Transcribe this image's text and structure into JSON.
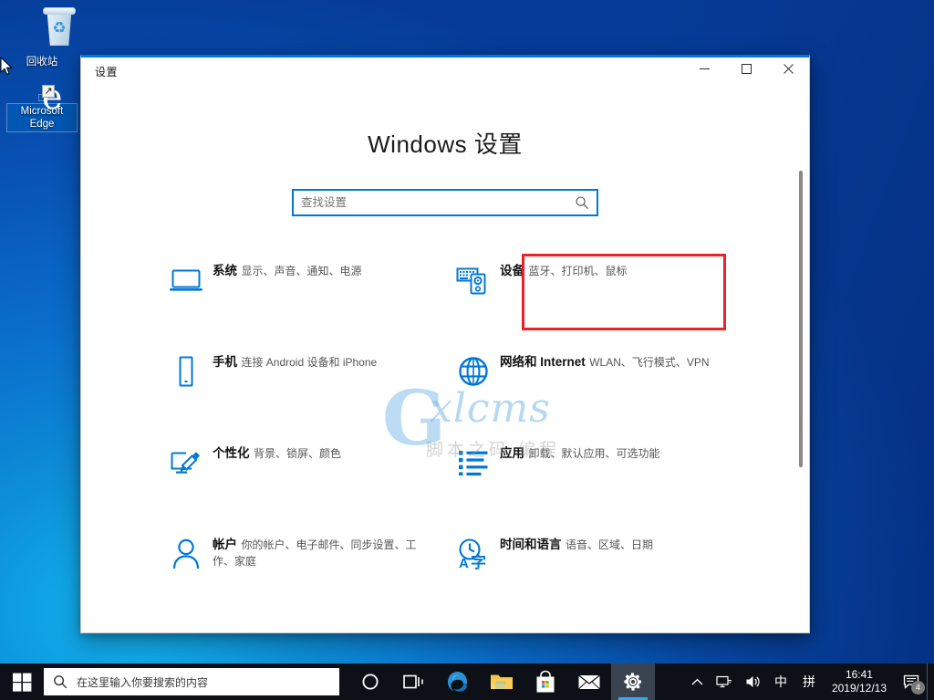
{
  "desktop": {
    "icons": [
      {
        "name": "recycle-bin",
        "label": "回收站",
        "icon": "recycle-bin-icon",
        "selected": false
      },
      {
        "name": "microsoft-edge",
        "label": "Microsoft Edge",
        "icon": "edge-icon",
        "selected": true,
        "shortcut_arrow": "↗"
      }
    ],
    "wallpaper_colors": {
      "primary": "#0d8fd8",
      "secondary": "#053a8f"
    }
  },
  "window": {
    "title": "设置",
    "accent_color": "#0078d7",
    "controls": {
      "minimize": "—",
      "maximize": "▢",
      "close": "✕"
    },
    "page_title": "Windows 设置",
    "search": {
      "placeholder": "查找设置",
      "value": "",
      "icon": "search-icon",
      "focused": true
    },
    "scrollbar": {
      "visible": true,
      "thumb_position_percent": 0
    },
    "tiles": [
      {
        "id": "system",
        "icon": "monitor-icon",
        "name": "系统",
        "desc": "显示、声音、通知、电源",
        "highlighted": false
      },
      {
        "id": "devices",
        "icon": "devices-icon",
        "name": "设备",
        "desc": "蓝牙、打印机、鼠标",
        "highlighted": true
      },
      {
        "id": "phone",
        "icon": "phone-icon",
        "name": "手机",
        "desc": "连接 Android 设备和 iPhone",
        "highlighted": false
      },
      {
        "id": "network",
        "icon": "globe-icon",
        "name": "网络和 Internet",
        "desc": "WLAN、飞行模式、VPN",
        "highlighted": false
      },
      {
        "id": "personalization",
        "icon": "brush-icon",
        "name": "个性化",
        "desc": "背景、锁屏、颜色",
        "highlighted": false
      },
      {
        "id": "apps",
        "icon": "list-icon",
        "name": "应用",
        "desc": "卸载、默认应用、可选功能",
        "highlighted": false
      },
      {
        "id": "accounts",
        "icon": "person-icon",
        "name": "帐户",
        "desc": "你的帐户、电子邮件、同步设置、工作、家庭",
        "highlighted": false
      },
      {
        "id": "time-language",
        "icon": "clock-language-icon",
        "name": "时间和语言",
        "desc": "语音、区域、日期",
        "highlighted": false
      }
    ],
    "annotation": {
      "color": "#ec2227",
      "target_tile": "devices"
    }
  },
  "watermark": {
    "letter": "G",
    "name": "xlcms",
    "subtitle": "脚本之码 编程"
  },
  "taskbar": {
    "start": {
      "icon": "windows-logo-icon",
      "label": "开始"
    },
    "search": {
      "icon": "search-icon",
      "placeholder": "在这里输入你要搜索的内容"
    },
    "icons": [
      {
        "id": "cortana",
        "icon": "cortana-circle-icon",
        "active": false
      },
      {
        "id": "task-view",
        "icon": "task-view-icon",
        "active": false
      },
      {
        "id": "edge",
        "icon": "edge-icon",
        "active": false
      },
      {
        "id": "file-explorer",
        "icon": "folder-icon",
        "active": false
      },
      {
        "id": "microsoft-store",
        "icon": "store-bag-icon",
        "active": false
      },
      {
        "id": "mail",
        "icon": "mail-envelope-icon",
        "active": false
      },
      {
        "id": "settings",
        "icon": "gear-icon",
        "active": true
      }
    ],
    "tray": {
      "show_hidden": {
        "icon": "chevron-up-icon",
        "glyph": "⌃"
      },
      "network": {
        "icon": "network-monitor-icon"
      },
      "volume": {
        "icon": "speaker-icon"
      },
      "ime_mode": "中",
      "ime_pinyin": "拼",
      "clock": {
        "time": "16:41",
        "date": "2019/12/13"
      },
      "notifications": {
        "icon": "action-center-icon",
        "badge": "4"
      }
    }
  }
}
